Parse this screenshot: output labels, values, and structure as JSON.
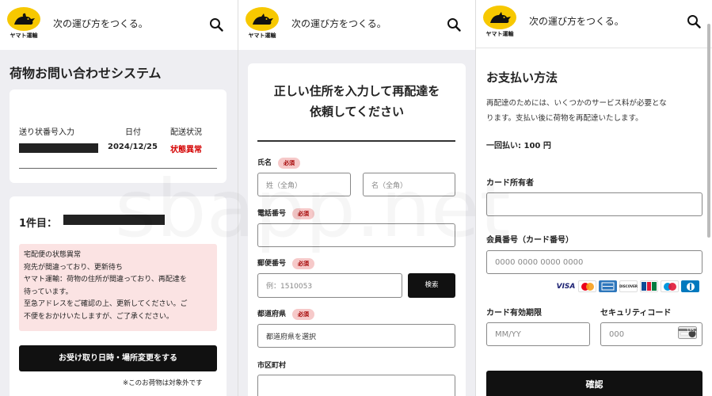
{
  "header": {
    "brand": "ヤマト運輸",
    "slogan": "次の運び方をつくる。"
  },
  "panel1": {
    "title": "荷物お問い合わせシステム",
    "col_tracking": "送り状番号入力",
    "col_date": "日付",
    "col_status": "配送状況",
    "date_value": "2024/12/25",
    "status_value": "状態異常",
    "item_label": "1件目：",
    "alert_lines": [
      "宅配便の状態異常",
      "宛先が間違っており、更新待ち",
      "ヤマト運輸：荷物の住所が間違っており、再配達を",
      "待っています。",
      "至急アドレスをご確認の上、更新してください。ご",
      "不便をおかけいたしますが、ご了承ください。"
    ],
    "action_button": "お受け取り日時・場所変更をする",
    "footnote": "※このお荷物は対象外です"
  },
  "panel2": {
    "heading_line1": "正しい住所を入力して再配達を",
    "heading_line2": "依頼してください",
    "required_badge": "必須",
    "name_label": "氏名",
    "last_name_placeholder": "姓（全角）",
    "first_name_placeholder": "名（全角）",
    "phone_label": "電話番号",
    "postal_label": "郵便番号",
    "postal_placeholder": "例：1510053",
    "search_button": "検索",
    "prefecture_label": "都道府県",
    "prefecture_select": "都道府県を選択",
    "city_label": "市区町村"
  },
  "panel3": {
    "title": "お支払い方法",
    "desc_line1": "再配達のためには、いくつかのサービス料が必要とな",
    "desc_line2": "ります。支払い後に荷物を再配達いたします。",
    "fee": "一回払い: 100 円",
    "holder_label": "カード所有者",
    "number_label": "会員番号（カード番号）",
    "number_placeholder": "0000 0000 0000 0000",
    "card_brands": [
      "VISA",
      "MasterCard",
      "AMEX",
      "DISCOVER",
      "JCB",
      "Maestro",
      "Diners"
    ],
    "expiry_label": "カード有効期限",
    "expiry_placeholder": "MM/YY",
    "cvc_label": "セキュリティコード",
    "cvc_placeholder": "000",
    "cvc_hint": "135",
    "confirm_button": "確認"
  },
  "watermark": "sbapp.net",
  "colors": {
    "brand_yellow": "#f7c800",
    "status_red": "#d40000",
    "alert_bg": "#fbe3e3",
    "badge_bg": "#f6c9c9"
  }
}
